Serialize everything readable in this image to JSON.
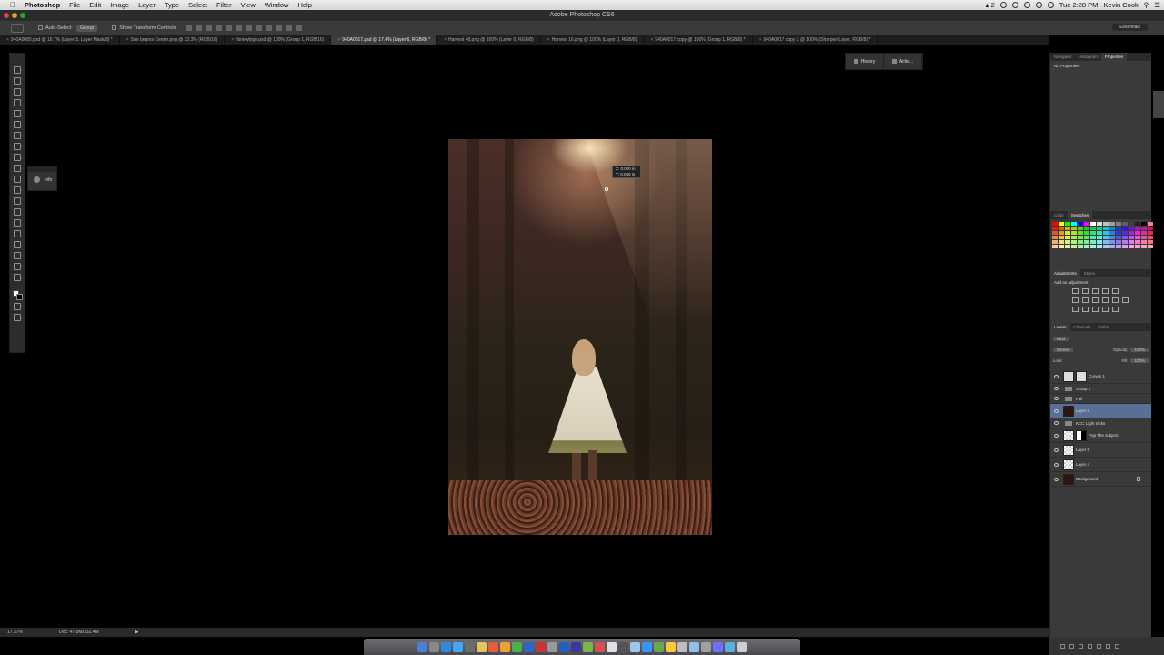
{
  "menubar": {
    "app_name": "Photoshop",
    "items": [
      "File",
      "Edit",
      "Image",
      "Layer",
      "Type",
      "Select",
      "Filter",
      "View",
      "Window",
      "Help"
    ],
    "clock": "Tue 2:28 PM",
    "user": "Kevin Cook",
    "status_text": "2"
  },
  "window": {
    "title": "Adobe Photoshop CS6"
  },
  "options": {
    "auto_select_label": "Auto-Select:",
    "auto_select_value": "Group",
    "transform_label": "Show Transform Controls",
    "workspace": "Essentials"
  },
  "tabs": [
    {
      "label": "940A0085.psd @ 16.7% (Layer 3, Layer Mask/8) *"
    },
    {
      "label": "Sun beams Center.png @ 33.3% (RGB/16)"
    },
    {
      "label": "lfsnewlogo.psd @ 100% (Group 1, RGB/16)"
    },
    {
      "label": "940A0017.psd @ 17.4% (Layer 6, RGB/8) *"
    },
    {
      "label": "Harvest 48.png @ 100% (Layer 0, RGB/8)"
    },
    {
      "label": "Harvest 16.png @ 100% (Layer 0, RGB/8)"
    },
    {
      "label": "940A0017 copy @ 100% (Group 1, RGB/8) *"
    },
    {
      "label": "940A0017 copy 2 @ 100% (Sharpen Layer, RGB/8) *"
    }
  ],
  "info_panel": {
    "label": "Info"
  },
  "canvas_tooltip": {
    "line1": "X: 0.000 in",
    "line2": "Y: 0.030 in"
  },
  "collapsed_panels": {
    "history": "History",
    "actions": "Actio..."
  },
  "right_dock": {
    "top_tabs": [
      "Navigator",
      "Histogram",
      "Properties"
    ],
    "properties_text": "No Properties",
    "swatch_tabs": [
      "Color",
      "Swatches"
    ],
    "adjust_tabs": [
      "Adjustments",
      "Styles"
    ],
    "adjust_title": "Add an adjustment",
    "layer_tabs": [
      "Layers",
      "Channels",
      "Paths"
    ],
    "kind": "Kind",
    "blend_mode": "Screen",
    "opacity_label": "Opacity:",
    "opacity_value": "100%",
    "lock_label": "Lock:",
    "fill_label": "Fill:",
    "fill_value": "100%"
  },
  "layers": [
    {
      "name": "Curves 1",
      "type": "adjustment"
    },
    {
      "name": "Group 1",
      "type": "group"
    },
    {
      "name": "Fall",
      "type": "group"
    },
    {
      "name": "Layer 6",
      "type": "layer",
      "selected": true
    },
    {
      "name": "KCC Light tricks",
      "type": "group"
    },
    {
      "name": "Pop The subject",
      "type": "masked"
    },
    {
      "name": "Layer 5",
      "type": "layer"
    },
    {
      "name": "Layer 4",
      "type": "layer"
    },
    {
      "name": "Background",
      "type": "background"
    }
  ],
  "status": {
    "zoom": "17.37%",
    "doc": "Doc: 47.9M/332.4M"
  },
  "colors": {
    "selection": "#5a6f95",
    "panel_bg": "#3a3a3a",
    "canvas_bg": "#000000"
  },
  "swatches": [
    "#ff0000",
    "#ffff00",
    "#00ff00",
    "#00ffff",
    "#0000ff",
    "#ff00ff",
    "#ffffff",
    "#e0e0e0",
    "#c0c0c0",
    "#a0a0a0",
    "#808080",
    "#606060",
    "#404040",
    "#202020",
    "#000000",
    "#ff8080"
  ]
}
